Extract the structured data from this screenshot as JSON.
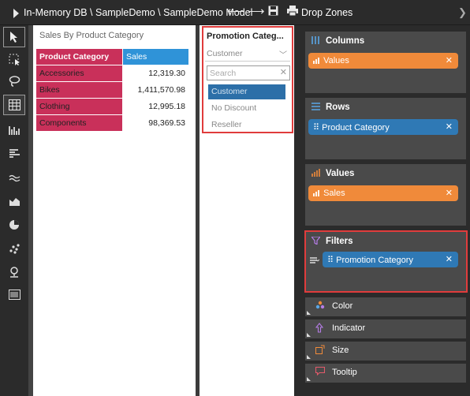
{
  "topbar": {
    "breadcrumb": "In-Memory DB \\ SampleDemo \\ SampleDemo Model",
    "dropzones_label": "Drop Zones",
    "icons": [
      "play-icon",
      "back-arrow-icon",
      "forward-arrow-icon",
      "save-icon",
      "print-icon",
      "chevron-right-icon"
    ]
  },
  "toolbar": {
    "tools": [
      "pointer-icon",
      "select-area-icon",
      "lasso-icon",
      "table-icon",
      "bar-chart-icon",
      "horizontal-bar-icon",
      "line-chart-icon",
      "area-chart-icon",
      "pie-chart-icon",
      "scatter-icon",
      "map-pin-icon",
      "barcode-icon"
    ]
  },
  "report": {
    "title": "Sales By Product Category",
    "columns": [
      "Product Category",
      "Sales"
    ],
    "rows": [
      {
        "category": "Accessories",
        "sales": "12,319.30"
      },
      {
        "category": "Bikes",
        "sales": "1,411,570.98"
      },
      {
        "category": "Clothing",
        "sales": "12,995.18"
      },
      {
        "category": "Components",
        "sales": "98,369.53"
      }
    ]
  },
  "filter": {
    "title": "Promotion Categ...",
    "selected": "Customer",
    "search_placeholder": "Search",
    "options": [
      "Customer",
      "No Discount",
      "Reseller"
    ]
  },
  "dropzones": {
    "columns": {
      "label": "Columns",
      "chip": "Values"
    },
    "rows": {
      "label": "Rows",
      "chip": "Product Category"
    },
    "values": {
      "label": "Values",
      "chip": "Sales"
    },
    "filters": {
      "label": "Filters",
      "chip": "Promotion Category"
    },
    "color": {
      "label": "Color"
    },
    "indicator": {
      "label": "Indicator"
    },
    "size": {
      "label": "Size"
    },
    "tooltip": {
      "label": "Tooltip"
    }
  },
  "colors": {
    "category_header": "#c9305a",
    "sales_header": "#2f93d8",
    "chip_orange": "#f08a3a",
    "chip_blue": "#2f79b5",
    "highlight_red": "#e03c3c"
  }
}
